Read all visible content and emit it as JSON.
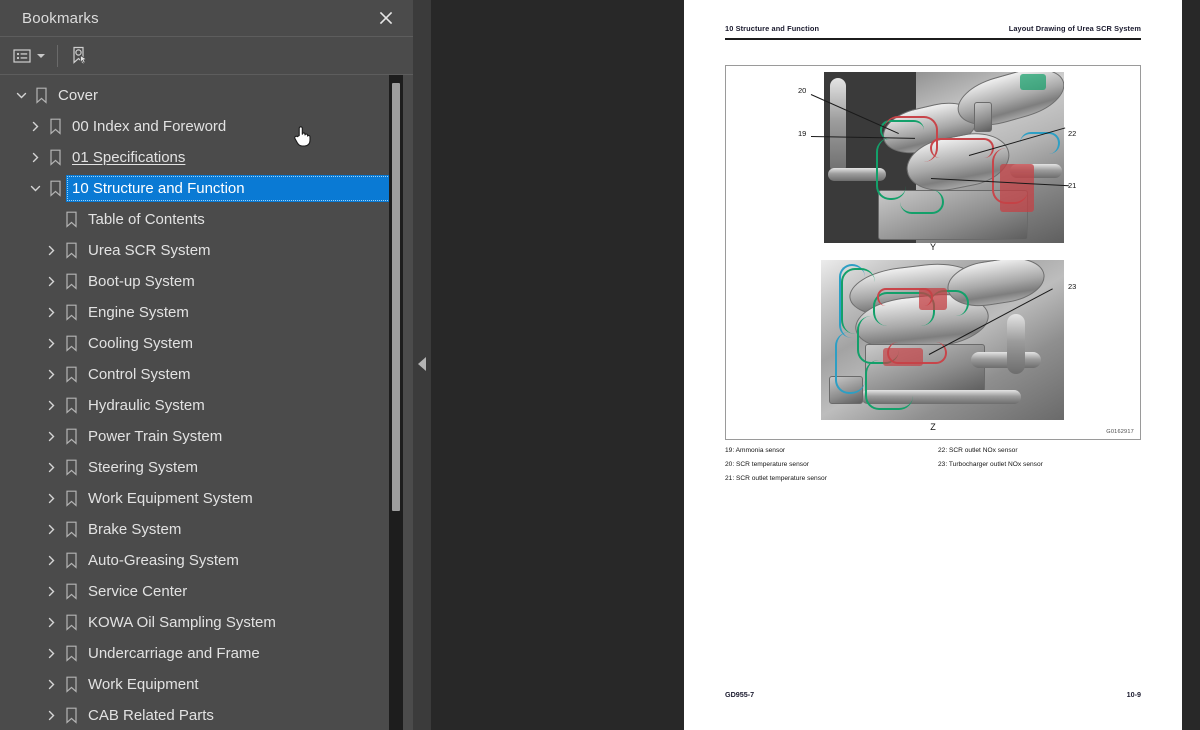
{
  "sidebar": {
    "title": "Bookmarks",
    "close_icon": "close-icon",
    "toolbar": {
      "list_options_icon": "bookmark-list-options-icon",
      "dropdown_icon": "chevron-down-icon",
      "new_bookmark_icon": "new-bookmark-icon"
    },
    "tree": [
      {
        "label": "Cover",
        "depth": 0,
        "twisty": "expanded",
        "state": "normal"
      },
      {
        "label": "00 Index and Foreword",
        "depth": 1,
        "twisty": "collapsed",
        "state": "normal"
      },
      {
        "label": "01 Specifications",
        "depth": 1,
        "twisty": "collapsed",
        "state": "hover"
      },
      {
        "label": "10 Structure and Function",
        "depth": 1,
        "twisty": "expanded",
        "state": "selected"
      },
      {
        "label": "Table of Contents",
        "depth": 2,
        "twisty": "none",
        "state": "normal"
      },
      {
        "label": "Urea SCR System",
        "depth": 2,
        "twisty": "collapsed",
        "state": "normal"
      },
      {
        "label": "Boot-up System",
        "depth": 2,
        "twisty": "collapsed",
        "state": "normal"
      },
      {
        "label": "Engine System",
        "depth": 2,
        "twisty": "collapsed",
        "state": "normal"
      },
      {
        "label": "Cooling System",
        "depth": 2,
        "twisty": "collapsed",
        "state": "normal"
      },
      {
        "label": "Control System",
        "depth": 2,
        "twisty": "collapsed",
        "state": "normal"
      },
      {
        "label": "Hydraulic System",
        "depth": 2,
        "twisty": "collapsed",
        "state": "normal"
      },
      {
        "label": "Power Train System",
        "depth": 2,
        "twisty": "collapsed",
        "state": "normal"
      },
      {
        "label": "Steering System",
        "depth": 2,
        "twisty": "collapsed",
        "state": "normal"
      },
      {
        "label": "Work Equipment System",
        "depth": 2,
        "twisty": "collapsed",
        "state": "normal"
      },
      {
        "label": "Brake System",
        "depth": 2,
        "twisty": "collapsed",
        "state": "normal"
      },
      {
        "label": "Auto-Greasing System",
        "depth": 2,
        "twisty": "collapsed",
        "state": "normal"
      },
      {
        "label": "Service Center",
        "depth": 2,
        "twisty": "collapsed",
        "state": "normal"
      },
      {
        "label": "KOWA Oil Sampling System",
        "depth": 2,
        "twisty": "collapsed",
        "state": "normal"
      },
      {
        "label": "Undercarriage and Frame",
        "depth": 2,
        "twisty": "collapsed",
        "state": "normal"
      },
      {
        "label": "Work Equipment",
        "depth": 2,
        "twisty": "collapsed",
        "state": "normal"
      },
      {
        "label": "CAB Related Parts",
        "depth": 2,
        "twisty": "collapsed",
        "state": "normal"
      }
    ]
  },
  "splitter": {
    "collapse_icon": "collapse-panel-arrow-icon"
  },
  "document": {
    "header_left": "10 Structure and Function",
    "header_right": "Layout Drawing of Urea SCR System",
    "figure_top_letter": "Y",
    "figure_bottom_letter": "Z",
    "drawing_id": "G0162917",
    "callouts_top": [
      "20",
      "19",
      "22",
      "21"
    ],
    "callouts_bottom": [
      "23"
    ],
    "legend_left": [
      "19: Ammonia sensor",
      "20: SCR temperature sensor",
      "21: SCR outlet temperature sensor"
    ],
    "legend_right": [
      "22: SCR outlet NOx sensor",
      "23: Turbocharger outlet NOx sensor"
    ],
    "footer_left": "GD955-7",
    "footer_right": "10-9"
  },
  "colors": {
    "panel_bg": "#4b4b4b",
    "selection_blue": "#0a7ad4",
    "viewer_bg": "#282828",
    "page_white": "#ffffff",
    "hose_green": "#13a06a",
    "hose_red": "#c8454a",
    "hose_blue": "#2d9fc4"
  },
  "cursor": {
    "type": "pointing-hand"
  }
}
